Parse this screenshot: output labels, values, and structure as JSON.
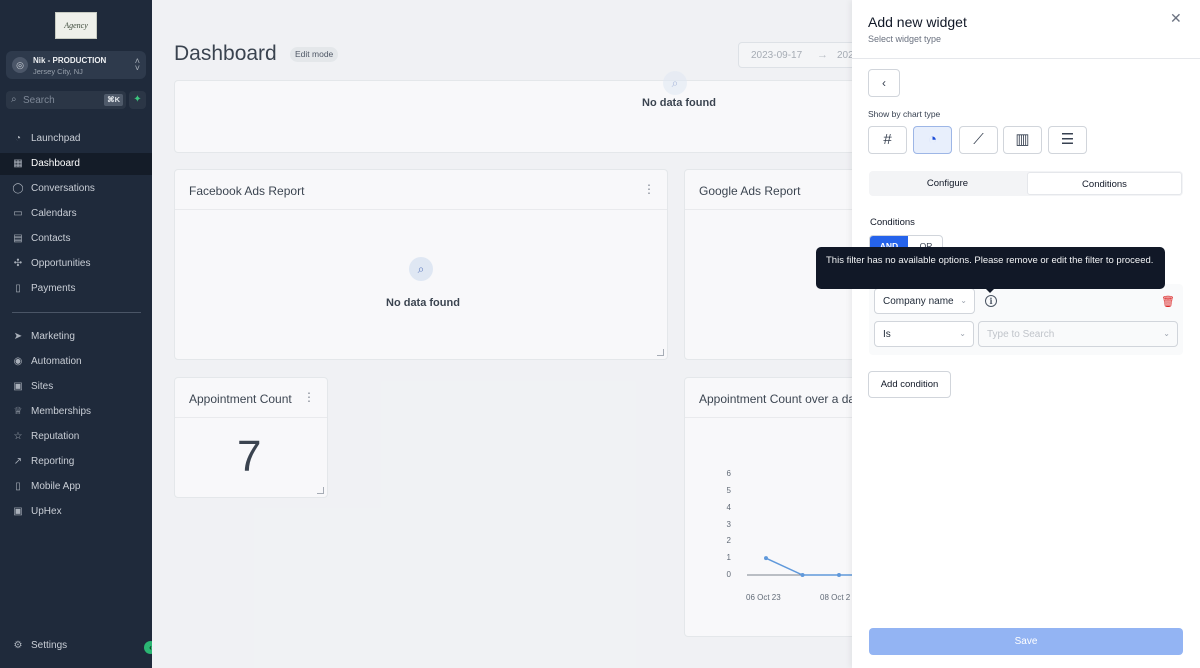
{
  "sidebar": {
    "logo_text": "Agency",
    "account": {
      "name": "Nik - PRODUCTION",
      "location": "Jersey City, NJ"
    },
    "search": {
      "placeholder": "Search",
      "shortcut": "⌘K"
    },
    "items": [
      {
        "label": "Launchpad",
        "icon": "rocket-icon",
        "glyph": "◔"
      },
      {
        "label": "Dashboard",
        "icon": "dashboard-icon",
        "glyph": "▦",
        "active": true
      },
      {
        "label": "Conversations",
        "icon": "chat-icon",
        "glyph": "◯"
      },
      {
        "label": "Calendars",
        "icon": "calendar-icon",
        "glyph": "▭"
      },
      {
        "label": "Contacts",
        "icon": "contacts-icon",
        "glyph": "▤"
      },
      {
        "label": "Opportunities",
        "icon": "opportunities-icon",
        "glyph": "✣"
      },
      {
        "label": "Payments",
        "icon": "payments-icon",
        "glyph": "▯"
      },
      {
        "label": "Marketing",
        "icon": "marketing-icon",
        "glyph": "➤"
      },
      {
        "label": "Automation",
        "icon": "automation-icon",
        "glyph": "◉"
      },
      {
        "label": "Sites",
        "icon": "sites-icon",
        "glyph": "▣"
      },
      {
        "label": "Memberships",
        "icon": "memberships-icon",
        "glyph": "♕"
      },
      {
        "label": "Reputation",
        "icon": "star-icon",
        "glyph": "☆"
      },
      {
        "label": "Reporting",
        "icon": "reporting-icon",
        "glyph": "↗"
      },
      {
        "label": "Mobile App",
        "icon": "mobile-icon",
        "glyph": "▯"
      },
      {
        "label": "UpHex",
        "icon": "uphex-icon",
        "glyph": "▣"
      }
    ],
    "settings_label": "Settings"
  },
  "main": {
    "title": "Dashboard",
    "edit_badge": "Edit mode",
    "date_start": "2023-09-17",
    "date_end": "202",
    "no_data": "No data found",
    "cards": {
      "facebook": "Facebook Ads Report",
      "google": "Google Ads Report",
      "appt_count": "Appointment Count",
      "appt_over": "Appointment Count over a da"
    },
    "appt_value": "7"
  },
  "chart_data": {
    "type": "line",
    "title": "",
    "xlabel": "",
    "ylabel": "",
    "y_ticks": [
      "6",
      "5",
      "4",
      "3",
      "2",
      "1",
      "0"
    ],
    "ylim": [
      0,
      6
    ],
    "x_labels": [
      "06 Oct 23",
      "08 Oct 2"
    ],
    "series": [
      {
        "values": [
          1,
          0,
          0,
          0
        ]
      }
    ],
    "color": "#4a8bd6"
  },
  "panel": {
    "title": "Add new widget",
    "subtitle": "Select widget type",
    "show_by": "Show by chart type",
    "chart_types": [
      {
        "icon": "hash-icon",
        "glyph": "#"
      },
      {
        "icon": "pie-chart-icon",
        "glyph": "◔",
        "selected": true
      },
      {
        "icon": "line-chart-icon",
        "glyph": "⟋"
      },
      {
        "icon": "bar-chart-icon",
        "glyph": "▥"
      },
      {
        "icon": "horizontal-bar-chart-icon",
        "glyph": "☰"
      }
    ],
    "tabs": [
      "Configure",
      "Conditions"
    ],
    "conditions_label": "Conditions",
    "and_label": "AND",
    "or_label": "OR",
    "tooltip": "This filter has no available options. Please remove or edit the filter to proceed.",
    "field": "Company name",
    "operator": "Is",
    "value_placeholder": "Type to Search",
    "add_condition": "Add condition",
    "save": "Save"
  }
}
